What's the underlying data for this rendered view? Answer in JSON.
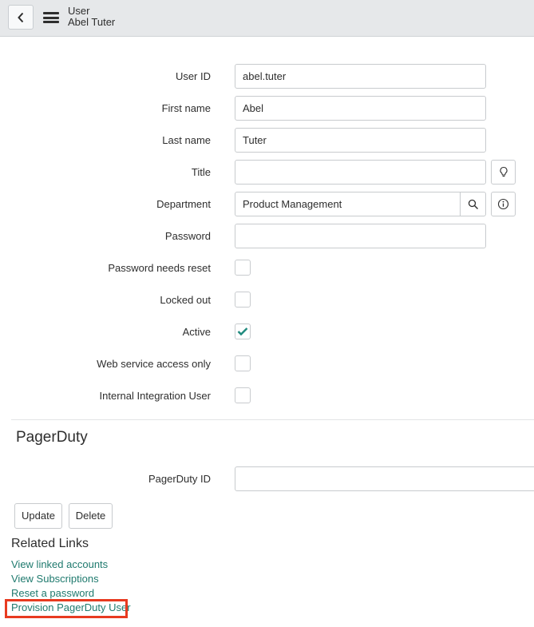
{
  "header": {
    "back_label": "Back",
    "table_name": "User",
    "record_name": "Abel Tuter"
  },
  "form": {
    "user_id": {
      "label": "User ID",
      "value": "abel.tuter"
    },
    "first_name": {
      "label": "First name",
      "value": "Abel"
    },
    "last_name": {
      "label": "Last name",
      "value": "Tuter"
    },
    "title": {
      "label": "Title",
      "value": ""
    },
    "department": {
      "label": "Department",
      "value": "Product Management"
    },
    "password": {
      "label": "Password",
      "value": ""
    },
    "password_needs_reset": {
      "label": "Password needs reset",
      "checked": false
    },
    "locked_out": {
      "label": "Locked out",
      "checked": false
    },
    "active": {
      "label": "Active",
      "checked": true
    },
    "web_service_access_only": {
      "label": "Web service access only",
      "checked": false
    },
    "internal_integration_user": {
      "label": "Internal Integration User",
      "checked": false
    }
  },
  "pagerduty": {
    "section_title": "PagerDuty",
    "id_label": "PagerDuty ID",
    "id_value": ""
  },
  "actions": {
    "update_label": "Update",
    "delete_label": "Delete"
  },
  "related_links": {
    "title": "Related Links",
    "links": [
      "View linked accounts",
      "View Subscriptions",
      "Reset a password",
      "Provision PagerDuty User"
    ]
  },
  "colors": {
    "link": "#1f7a6e",
    "check": "#1f8a7e",
    "highlight": "#e83a20"
  }
}
